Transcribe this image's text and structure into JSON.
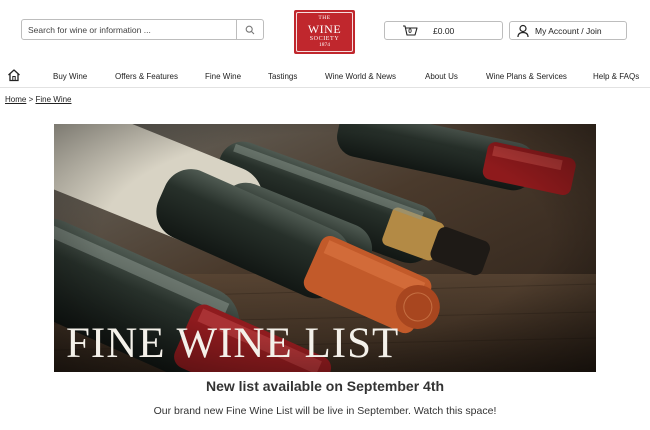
{
  "header": {
    "search": {
      "placeholder": "Search for wine or information ...",
      "value": ""
    },
    "logo": {
      "line1": "THE",
      "line2": "WINE",
      "line3": "SOCIETY",
      "line4": "1874",
      "color": "#c0272d"
    },
    "basket": {
      "count": "0",
      "total": "£0.00"
    },
    "account": {
      "label": "My Account / Join"
    }
  },
  "nav": {
    "items": [
      {
        "label": "Buy Wine"
      },
      {
        "label": "Offers & Features"
      },
      {
        "label": "Fine Wine"
      },
      {
        "label": "Tastings"
      },
      {
        "label": "Wine World & News"
      },
      {
        "label": "About Us"
      },
      {
        "label": "Wine Plans & Services"
      },
      {
        "label": "Help & FAQs"
      }
    ]
  },
  "breadcrumb": {
    "home": "Home",
    "separator": ">",
    "current": "Fine Wine"
  },
  "hero": {
    "title": "FINE WINE LIST"
  },
  "announcement": {
    "headline": "New list available on September 4th",
    "body": "Our brand new Fine Wine List will be live in September. Watch this space!"
  }
}
